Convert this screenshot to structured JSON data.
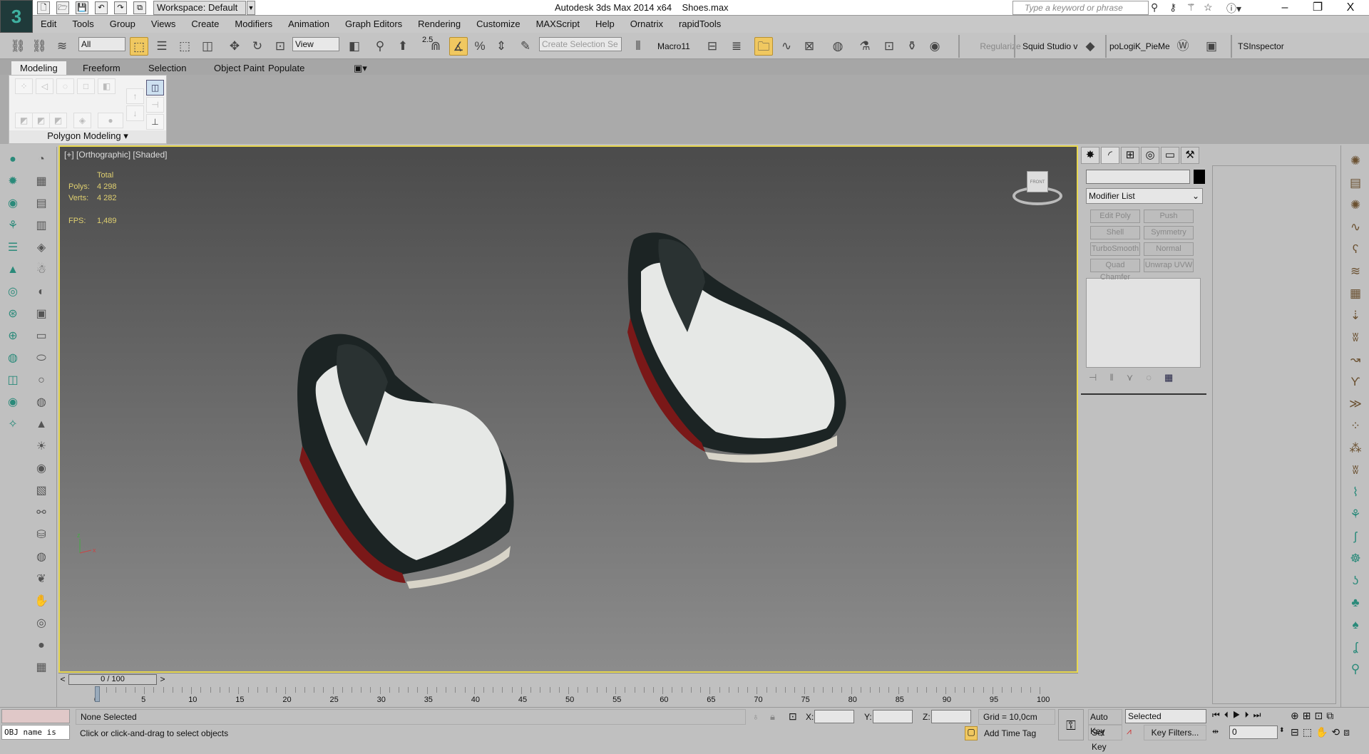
{
  "titlebar": {
    "workspace": "Workspace: Default",
    "app_title": "Autodesk 3ds Max  2014 x64",
    "file": "Shoes.max",
    "search_placeholder": "Type a keyword or phrase",
    "quick_access": [
      "new-icon",
      "open-icon",
      "save-icon",
      "undo-icon",
      "redo-icon",
      "project-icon"
    ],
    "window": {
      "minimize": "–",
      "restore": "❐",
      "close": "X"
    }
  },
  "menu": [
    "Edit",
    "Tools",
    "Group",
    "Views",
    "Create",
    "Modifiers",
    "Animation",
    "Graph Editors",
    "Rendering",
    "Customize",
    "MAXScript",
    "Help",
    "Ornatrix",
    "rapidTools"
  ],
  "toolbar": {
    "selection_filter": "All",
    "reference_coord": "View",
    "named_selection_placeholder": "Create Selection Se",
    "snap_value": "2.5",
    "macro": "Macro11",
    "buttons": [
      "Regularize",
      "Squid Studio v",
      "poLogiK_PieMe",
      "TSInspector"
    ]
  },
  "ribbon": {
    "tabs": [
      "Modeling",
      "Freeform",
      "Selection",
      "Object Paint",
      "Populate"
    ],
    "active_tab": "Modeling",
    "panel_label": "Polygon Modeling"
  },
  "viewport": {
    "label_plus": "[+]",
    "label_view": "[Orthographic]",
    "label_shading": "[Shaded]",
    "stats": {
      "header": "Total",
      "polys_label": "Polys:",
      "polys": "4 298",
      "verts_label": "Verts:",
      "verts": "4 282",
      "fps_label": "FPS:",
      "fps": "1,489"
    },
    "viewcube": "FRONT",
    "active_border_color": "#e8d850"
  },
  "command_panel": {
    "modifier_list": "Modifier List",
    "object_color": "#000000",
    "modifiers": [
      "Edit Poly",
      "Push",
      "Shell",
      "Symmetry",
      "TurboSmooth",
      "Normal",
      "Quad Chamfer",
      "Unwrap UVW"
    ]
  },
  "timeline": {
    "frame": "0 / 100",
    "ticks": [
      0,
      5,
      10,
      15,
      20,
      25,
      30,
      35,
      40,
      45,
      50,
      55,
      60,
      65,
      70,
      75,
      80,
      85,
      90,
      95,
      100
    ]
  },
  "status": {
    "selection": "None Selected",
    "prompt": "Click or click-and-drag to select objects",
    "maxscript": "OBJ name is",
    "x_label": "X:",
    "y_label": "Y:",
    "z_label": "Z:",
    "grid": "Grid = 10,0cm",
    "add_time_tag": "Add Time Tag",
    "auto_key": "Auto Key",
    "set_key": "Set Key",
    "key_mode": "Selected",
    "key_filters": "Key Filters...",
    "current_frame": "0"
  }
}
